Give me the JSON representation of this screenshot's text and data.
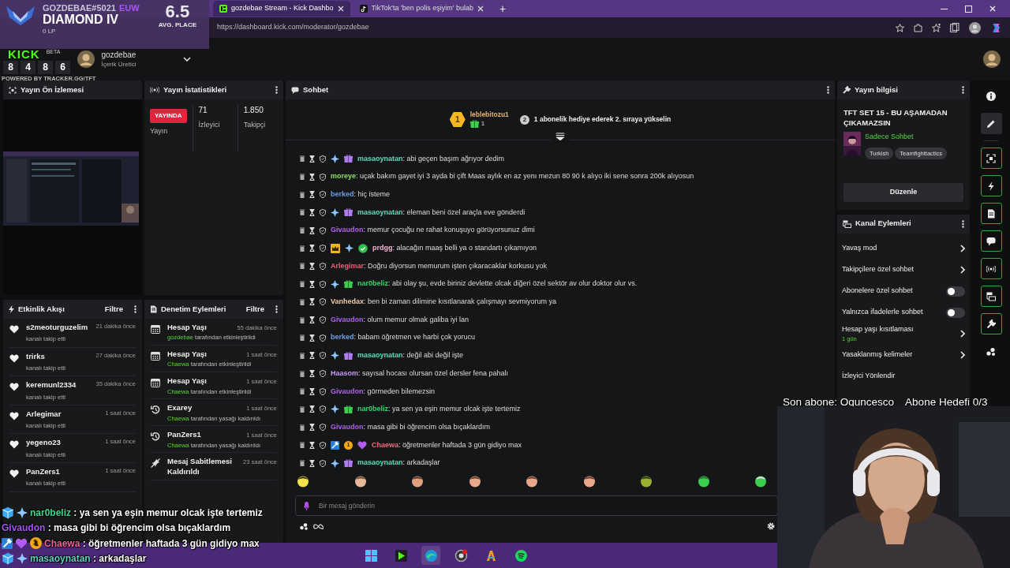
{
  "browser": {
    "tabs": [
      {
        "title": "gozdebae Stream - Kick Dashbo",
        "selected": true
      },
      {
        "title": "TikTok'ta 'ben polis eşiyim' bulab",
        "selected": false
      }
    ],
    "new_tab": "+",
    "url": "https://dashboard.kick.com/moderator/gozdebae"
  },
  "rank_overlay": {
    "player": "GOZDEBAE#5021",
    "region": "EUW",
    "rank": "DIAMOND IV",
    "lp": "0 LP",
    "avg_place": "6.5",
    "avg_label": "AVG. PLACE",
    "recent_places": [
      "8",
      "4",
      "8",
      "6"
    ],
    "credit": "POWERED BY TRACKER.GG/TFT"
  },
  "header": {
    "logo": "KICK",
    "logo_tag": "BETA",
    "user": "gozdebae",
    "role": "İçerik Üretici"
  },
  "preview_panel": {
    "title": "Yayın Ön İzlemesi"
  },
  "stats_panel": {
    "title": "Yayın İstatistikleri",
    "live_badge": "YAYINDA",
    "live_label": "Yayın",
    "stats": [
      {
        "value": "71",
        "label": "İzleyici"
      },
      {
        "value": "1.850",
        "label": "Takipçi"
      }
    ]
  },
  "events_panel": {
    "title": "Etkinlik Akışı",
    "filter": "Filtre",
    "items": [
      {
        "user": "s2meoturguzelim",
        "action": "kanalı takip etti",
        "time": "21 dakika önce"
      },
      {
        "user": "trirks",
        "action": "kanalı takip etti",
        "time": "27 dakika önce"
      },
      {
        "user": "keremunl2334",
        "action": "kanalı takip etti",
        "time": "35 dakika önce"
      },
      {
        "user": "Arlegimar",
        "action": "kanalı takip etti",
        "time": "1 saat önce"
      },
      {
        "user": "yegeno23",
        "action": "kanalı takip etti",
        "time": "1 saat önce"
      },
      {
        "user": "PanZers1",
        "action": "kanalı takip etti",
        "time": "1 saat önce"
      }
    ]
  },
  "moderation_panel": {
    "title": "Denetim Eylemleri",
    "filter": "Filtre",
    "items": [
      {
        "kind": "calendar",
        "title": "Hesap Yaşı",
        "time": "55 dakika önce",
        "actor": "gozdebae",
        "detail": "tarafından etkinleştirildi"
      },
      {
        "kind": "calendar",
        "title": "Hesap Yaşı",
        "time": "1 saat önce",
        "actor": "Chaewa",
        "detail": "tarafından etkinleştirildi"
      },
      {
        "kind": "calendar",
        "title": "Hesap Yaşı",
        "time": "1 saat önce",
        "actor": "Chaewa",
        "detail": "tarafından etkinleştirildi"
      },
      {
        "kind": "unban",
        "title": "Exarey",
        "time": "1 saat önce",
        "actor": "Chaewa",
        "detail": "tarafından yasağı kaldırıldı"
      },
      {
        "kind": "unban",
        "title": "PanZers1",
        "time": "1 saat önce",
        "actor": "Chaewa",
        "detail": "tarafından yasağı kaldırıldı"
      },
      {
        "kind": "unpin",
        "title": "Mesaj Sabitlemesi Kaldırıldı",
        "time": "23 saat önce"
      }
    ]
  },
  "chat": {
    "title": "Sohbet",
    "pinned": {
      "rank": "1",
      "user": "leblebitozu1",
      "gifts": "1",
      "next_rank": "2",
      "prompt": "1 abonelik hediye ederek 2. sıraya yükselin"
    },
    "messages": [
      {
        "user": "masaoynatan",
        "color": "#62d9b8",
        "badges": [
          {
            "kind": "sparkle"
          },
          {
            "kind": "gift",
            "color": "#b07cf0"
          }
        ],
        "text": ": abi geçen başım ağrıyor dedim"
      },
      {
        "user": "moreye",
        "color": "#8be05a",
        "text": ": uçak bakım gayet iyi 3 ayda bi çift Maas aylık en az yenı mezun 80 90 k alıyo iki sene sonra 200k alıyosun"
      },
      {
        "user": "berked",
        "color": "#6aa0e6",
        "text": ": hiç isteme"
      },
      {
        "user": "masaoynatan",
        "color": "#62d9b8",
        "badges": [
          {
            "kind": "sparkle"
          },
          {
            "kind": "gift",
            "color": "#b07cf0"
          }
        ],
        "text": ": eleman beni özel araçla eve gönderdi"
      },
      {
        "user": "Givaudon",
        "color": "#b062e6",
        "text": ": memur çocuğu ne rahat konuşuyo görüyorsunuz dimi"
      },
      {
        "user": "prdgg",
        "color": "#f2b3cf",
        "badges": [
          {
            "kind": "crown"
          },
          {
            "kind": "sparkle"
          },
          {
            "kind": "verified"
          }
        ],
        "text": ": alacağın maaş belli ya o standartı çıkamıyon"
      },
      {
        "user": "Arlegimar",
        "color": "#e8607a",
        "text": ": Doğru diyorsun memurum işten çıkaracaklar korkusu yok"
      },
      {
        "user": "nar0beliz",
        "color": "#39d36a",
        "badges": [
          {
            "kind": "sparkle"
          },
          {
            "kind": "gift",
            "color": "#3ccf4e"
          }
        ],
        "text": ": abi olay şu, evde biriniz devlette olcak diğeri özel sektör av olur doktor olur vs."
      },
      {
        "user": "Vanhedax",
        "color": "#f2c9a6",
        "text": ": ben bi zaman dilimine kısıtlanarak çalışmayı sevmiyorum ya"
      },
      {
        "user": "Givaudon",
        "color": "#b062e6",
        "text": ": olum memur olmak galiba iyi lan"
      },
      {
        "user": "berked",
        "color": "#6aa0e6",
        "text": ": babam öğretmen ve harbi çok yorucu"
      },
      {
        "user": "masaoynatan",
        "color": "#62d9b8",
        "badges": [
          {
            "kind": "sparkle"
          },
          {
            "kind": "gift",
            "color": "#b07cf0"
          }
        ],
        "text": ": değil abi değil işte"
      },
      {
        "user": "Haasom",
        "color": "#c49cf0",
        "text": ": sayısal hocası olursan özel dersler fena pahalı"
      },
      {
        "user": "Givaudon",
        "color": "#b062e6",
        "text": ": görmeden bilemezsin"
      },
      {
        "user": "nar0beliz",
        "color": "#39d36a",
        "badges": [
          {
            "kind": "sparkle"
          },
          {
            "kind": "gift",
            "color": "#3ccf4e"
          }
        ],
        "text": ": ya sen ya eşin memur olcak işte tertemiz"
      },
      {
        "user": "Givaudon",
        "color": "#b062e6",
        "text": ": masa gibi bi öğrencim olsa bıçaklardım"
      },
      {
        "user": "Chaewa",
        "color": "#f06a7c",
        "badges": [
          {
            "kind": "hammer"
          },
          {
            "kind": "coin",
            "text": "1"
          },
          {
            "kind": "heart"
          }
        ],
        "text": ": öğretmenler haftada 3 gün gidiyo max"
      },
      {
        "user": "masaoynatan",
        "color": "#62d9b8",
        "badges": [
          {
            "kind": "sparkle"
          },
          {
            "kind": "gift",
            "color": "#b07cf0"
          }
        ],
        "text": ": arkadaşlar"
      }
    ],
    "input": {
      "placeholder": "Bir mesaj gönderin"
    }
  },
  "stream_info": {
    "title": "Yayın bilgisi",
    "stream_title": "TFT SET 15 - BU AŞAMADAN ÇIKAMAZSIN",
    "category": "Sadece Sohbet",
    "tags": [
      "Turkish",
      "Teamfighttactics"
    ],
    "edit_button": "Düzenle"
  },
  "channel_actions": {
    "title": "Kanal Eylemleri",
    "items": [
      {
        "kind": "link",
        "label": "Yavaş mod"
      },
      {
        "kind": "link",
        "label": "Takipçilere özel sohbet"
      },
      {
        "kind": "toggle",
        "label": "Abonelere özel sohbet",
        "on": false
      },
      {
        "kind": "toggle",
        "label": "Yalnızca ifadelerle sohbet",
        "on": false
      },
      {
        "kind": "link",
        "label": "Hesap yaşı kısıtlaması",
        "value": "1 gün"
      },
      {
        "kind": "link",
        "label": "Yasaklanmış kelimeler"
      },
      {
        "kind": "plain",
        "label": "İzleyici Yönlendir"
      }
    ]
  },
  "rail": [
    {
      "on": false,
      "selected": false
    },
    {
      "on": false,
      "selected": true
    },
    {
      "on": true,
      "selected": false
    },
    {
      "on": true,
      "selected": false
    },
    {
      "on": true,
      "selected": false
    },
    {
      "on": true,
      "selected": false
    },
    {
      "on": true,
      "selected": false
    },
    {
      "on": true,
      "selected": false
    },
    {
      "on": true,
      "selected": false
    },
    {
      "on": false,
      "selected": false
    }
  ],
  "subscriber_goal": {
    "last_sub": "Son abone: Oguncesco",
    "goal": "Abone Hedefi 0/3"
  },
  "overlay_chat": [
    {
      "user": "nar0beliz",
      "color": "#3fd68f",
      "badges": [
        {
          "kind": "cube"
        },
        {
          "kind": "sparkle"
        }
      ],
      "text": ": ya sen ya eşin memur olcak işte tertemiz"
    },
    {
      "user": "Givaudon",
      "color": "#a855f7",
      "text": ": masa gibi bi öğrencim olsa bıçaklardım"
    },
    {
      "user": "Chaewa",
      "color": "#f06292",
      "badges": [
        {
          "kind": "hammer"
        },
        {
          "kind": "heart"
        },
        {
          "kind": "coin",
          "text": "1"
        }
      ],
      "text": ": öğretmenler haftada 3 gün gidiyo max"
    },
    {
      "user": "masaoynatan",
      "color": "#5fd0c0",
      "badges": [
        {
          "kind": "cube"
        },
        {
          "kind": "sparkle"
        }
      ],
      "text": ": arkadaşlar"
    }
  ]
}
